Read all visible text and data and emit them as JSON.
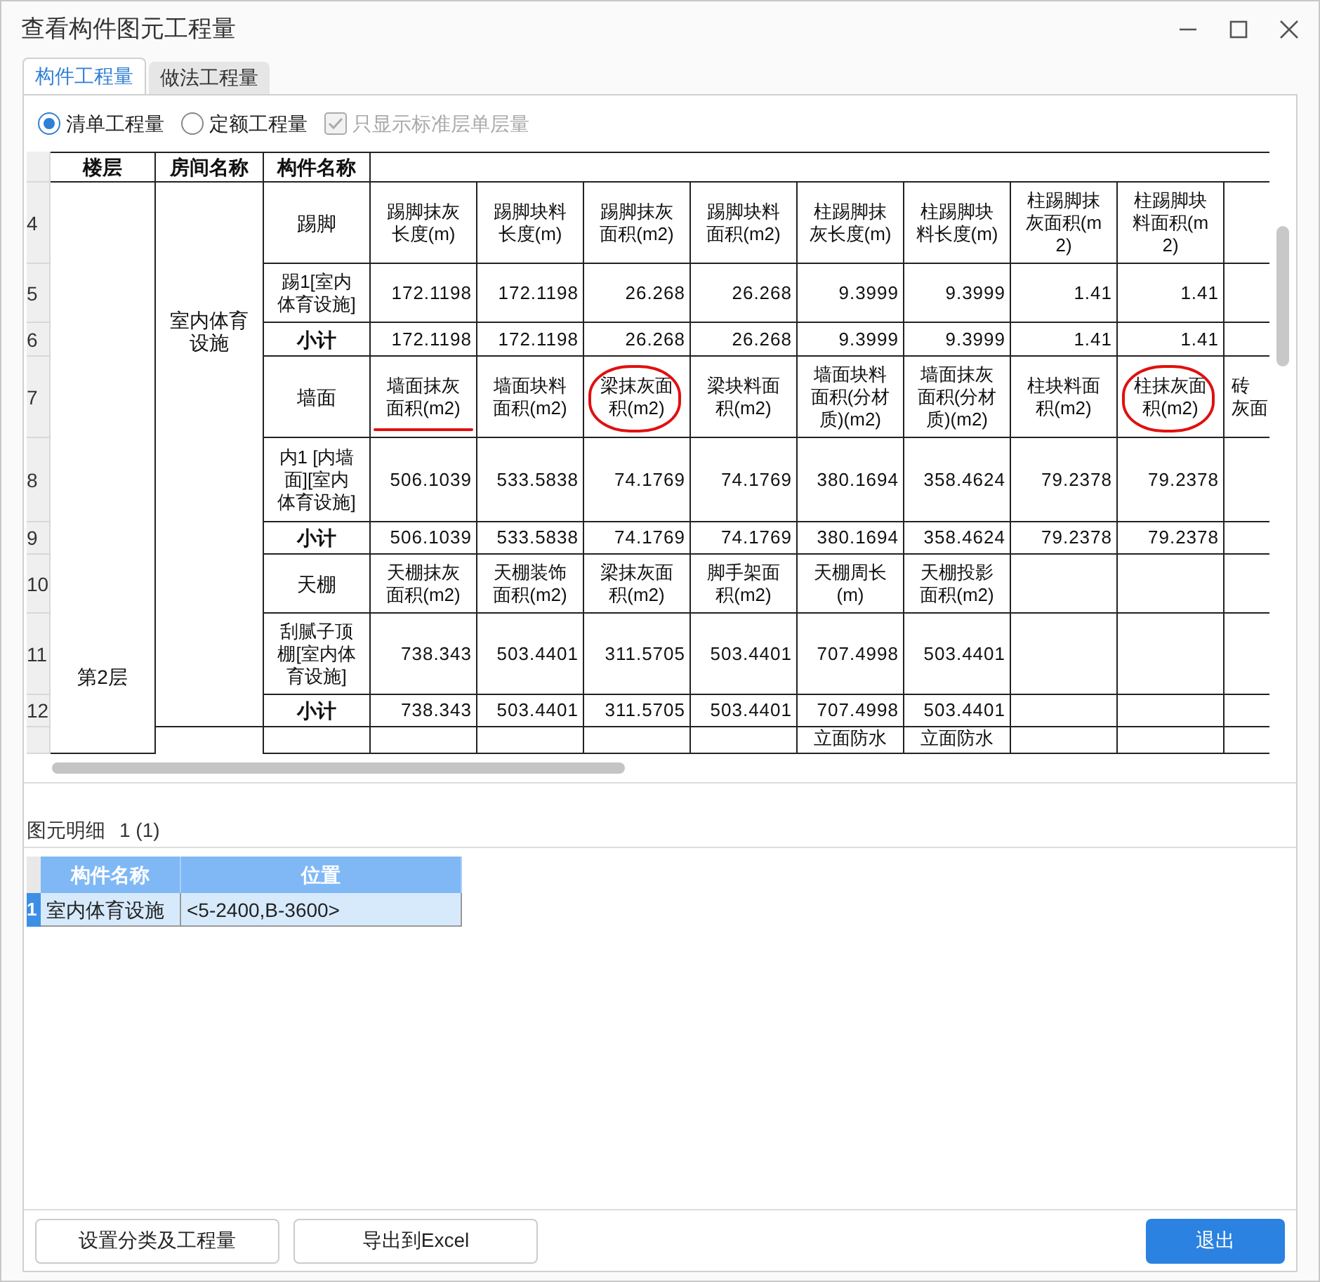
{
  "window": {
    "title": "查看构件图元工程量"
  },
  "tabs": [
    {
      "label": "构件工程量",
      "selected": true
    },
    {
      "label": "做法工程量",
      "selected": false
    }
  ],
  "options": [
    {
      "kind": "radio",
      "label": "清单工程量",
      "selected": true
    },
    {
      "kind": "radio",
      "label": "定额工程量",
      "selected": false
    },
    {
      "kind": "checkbox",
      "label": "只显示标准层单层量",
      "checked": true,
      "disabled": true
    }
  ],
  "table": {
    "columns": [
      "楼层",
      "房间名称",
      "构件名称"
    ],
    "floor": "第2层",
    "rooms": [
      {
        "name": "室内体育设施",
        "rows": [
          {
            "num": "4",
            "kind": "group",
            "component": "踢脚",
            "cells": [
              {
                "text": "踢脚抹灰长度(m)"
              },
              {
                "text": "踢脚块料长度(m)"
              },
              {
                "text": "踢脚抹灰面积(m2)"
              },
              {
                "text": "踢脚块料面积(m2)"
              },
              {
                "text": "柱踢脚抹灰长度(m)"
              },
              {
                "text": "柱踢脚块料长度(m)"
              },
              {
                "text": "柱踢脚抹灰面积(m2)"
              },
              {
                "text": "柱踢脚块料面积(m2)"
              },
              null
            ]
          },
          {
            "num": "5",
            "kind": "item",
            "component": "踢1[室内体育设施]",
            "cells": [
              "172.1198",
              "172.1198",
              "26.268",
              "26.268",
              "9.3999",
              "9.3999",
              "1.41",
              "1.41",
              null
            ]
          },
          {
            "num": "6",
            "kind": "subtotal",
            "component": "小计",
            "cells": [
              "172.1198",
              "172.1198",
              "26.268",
              "26.268",
              "9.3999",
              "9.3999",
              "1.41",
              "1.41",
              null
            ]
          },
          {
            "num": "7",
            "kind": "group",
            "component": "墙面",
            "cells": [
              {
                "text": "墙面抹灰面积(m2)",
                "underlined": true
              },
              {
                "text": "墙面块料面积(m2)"
              },
              {
                "text": "梁抹灰面积(m2)",
                "circled": true
              },
              {
                "text": "梁块料面积(m2)"
              },
              {
                "text": "墙面块料面积(分材质)(m2)"
              },
              {
                "text": "墙面抹灰面积(分材质)(m2)"
              },
              {
                "text": "柱块料面积(m2)"
              },
              {
                "text": "柱抹灰面积(m2)",
                "circled": true
              },
              {
                "lines": [
                  "砖",
                  "灰面"
                ]
              }
            ]
          },
          {
            "num": "8",
            "kind": "item",
            "component": "内1 [内墙面][室内体育设施]",
            "cells": [
              "506.1039",
              "533.5838",
              "74.1769",
              "74.1769",
              "380.1694",
              "358.4624",
              "79.2378",
              "79.2378",
              null
            ]
          },
          {
            "num": "9",
            "kind": "subtotal",
            "component": "小计",
            "cells": [
              "506.1039",
              "533.5838",
              "74.1769",
              "74.1769",
              "380.1694",
              "358.4624",
              "79.2378",
              "79.2378",
              null
            ]
          },
          {
            "num": "10",
            "kind": "group",
            "component": "天棚",
            "cells": [
              {
                "text": "天棚抹灰面积(m2)"
              },
              {
                "text": "天棚装饰面积(m2)"
              },
              {
                "text": "梁抹灰面积(m2)"
              },
              {
                "text": "脚手架面积(m2)"
              },
              {
                "text": "天棚周长(m)"
              },
              {
                "text": "天棚投影面积(m2)"
              },
              null,
              null,
              null
            ]
          },
          {
            "num": "11",
            "kind": "item",
            "component": "刮腻子顶棚[室内体育设施]",
            "cells": [
              "738.343",
              "503.4401",
              "311.5705",
              "503.4401",
              "707.4998",
              "503.4401",
              null,
              null,
              null
            ]
          },
          {
            "num": "12",
            "kind": "subtotal",
            "component": "小计",
            "cells": [
              "738.343",
              "503.4401",
              "311.5705",
              "503.4401",
              "707.4998",
              "503.4401",
              null,
              null,
              null
            ]
          }
        ]
      },
      {
        "rows": [
          {
            "kind": "group",
            "cells": [
              null,
              null,
              null,
              null,
              {
                "text": "立面防水"
              },
              {
                "text": "立面防水"
              },
              null,
              null,
              null
            ]
          }
        ]
      }
    ]
  },
  "detail": {
    "title": "图元明细",
    "count": "1 (1)",
    "columns": [
      "构件名称",
      "位置"
    ],
    "rows": [
      {
        "num": "1",
        "cells": [
          "室内体育设施",
          "<5-2400,B-3600>"
        ],
        "selected": true
      }
    ]
  },
  "buttons": [
    {
      "label": "设置分类及工程量",
      "kind": "normal"
    },
    {
      "label": "导出到Excel",
      "kind": "normal"
    },
    {
      "label": "退出",
      "kind": "primary"
    }
  ]
}
